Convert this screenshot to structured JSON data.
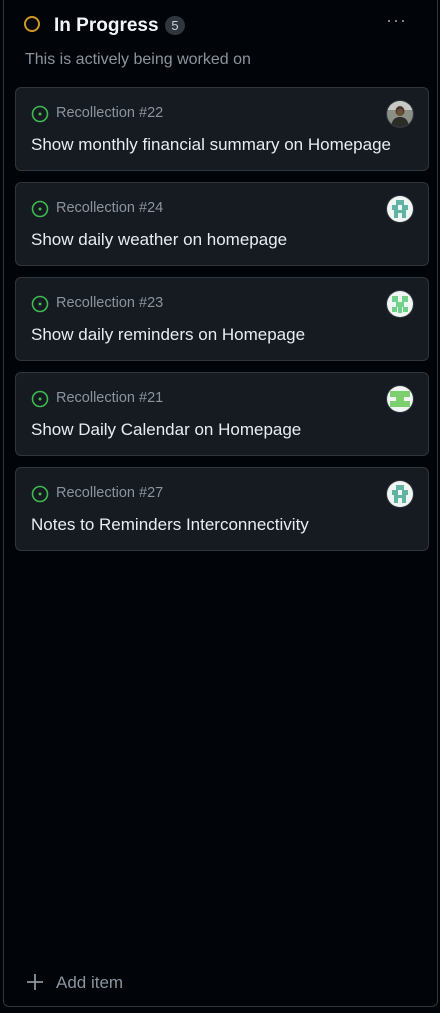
{
  "column": {
    "title": "In Progress",
    "count": "5",
    "more_label": "···",
    "description": "This is actively being worked on",
    "status_color": "#d29922"
  },
  "cards": [
    {
      "ref": "Recollection #22",
      "title": "Show monthly financial summary on Homepage",
      "avatar": "photo-avatar"
    },
    {
      "ref": "Recollection #24",
      "title": "Show daily weather on homepage",
      "avatar": "identicon-a"
    },
    {
      "ref": "Recollection #23",
      "title": "Show daily reminders on Homepage",
      "avatar": "identicon-b"
    },
    {
      "ref": "Recollection #21",
      "title": "Show Daily Calendar on Homepage",
      "avatar": "identicon-c"
    },
    {
      "ref": "Recollection #27",
      "title": "Notes to Reminders Interconnectivity",
      "avatar": "identicon-a"
    }
  ],
  "add_item": {
    "label": "Add item"
  },
  "colors": {
    "background": "#010409",
    "card": "#161b22",
    "border": "#30363d",
    "open_issue": "#3fb950"
  }
}
